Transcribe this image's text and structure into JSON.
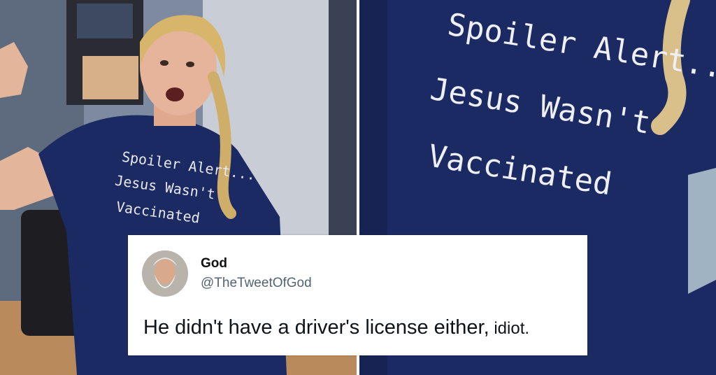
{
  "left_photo": {
    "shirt_text_lines": [
      "Spoiler Alert...",
      "Jesus Wasn't",
      "Vaccinated"
    ]
  },
  "right_photo": {
    "shirt_text_lines": [
      "Spoiler Alert...",
      "Jesus Wasn't",
      "Vaccinated"
    ]
  },
  "tweet": {
    "author_name": "God",
    "author_handle": "@TheTweetOfGod",
    "text_main": "He didn't have a driver's license either,",
    "text_end": " idiot."
  },
  "colors": {
    "shirt_navy": "#1c2a63",
    "room_wall": "#6f7f95",
    "handle_gray": "#536471"
  }
}
